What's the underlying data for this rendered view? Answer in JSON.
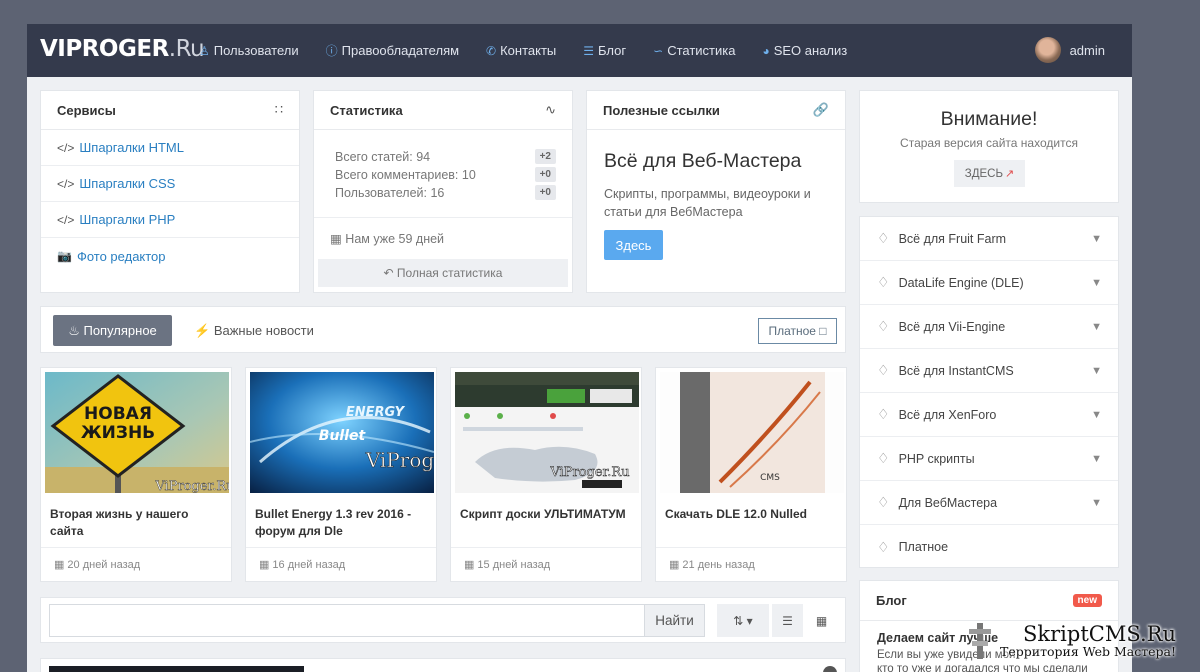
{
  "header": {
    "logo_main": "VIPROGER",
    "logo_suffix": ".Ru",
    "nav": [
      {
        "label": "Пользователи",
        "icon": "users-icon"
      },
      {
        "label": "Правообладателям",
        "icon": "info-icon"
      },
      {
        "label": "Контакты",
        "icon": "phone-icon"
      },
      {
        "label": "Блог",
        "icon": "stack-icon"
      },
      {
        "label": "Статистика",
        "icon": "chart-line-icon"
      },
      {
        "label": "SEO анализ",
        "icon": "pie-chart-icon"
      }
    ],
    "username": "admin"
  },
  "services": {
    "title": "Сервисы",
    "items": [
      {
        "label": "Шпаргалки HTML",
        "icon": "code-icon"
      },
      {
        "label": "Шпаргалки CSS",
        "icon": "code-icon"
      },
      {
        "label": "Шпаргалки PHP",
        "icon": "code-icon"
      },
      {
        "label": "Фото редактор",
        "icon": "camera-icon"
      }
    ]
  },
  "stats": {
    "title": "Статистика",
    "lines": [
      {
        "label": "Всего статей: 94",
        "badge": "+2"
      },
      {
        "label": "Всего комментариев: 10",
        "badge": "+0"
      },
      {
        "label": "Пользователей: 16",
        "badge": "+0"
      }
    ],
    "days": "Нам уже 59 дней",
    "full_link": "Полная статистика"
  },
  "links": {
    "title": "Полезные ссылки",
    "headline": "Всё для Веб-Мастера",
    "desc_line1": "Скрипты, программы, видеоуроки и",
    "desc_line2": "статьи для ВебМастера",
    "button": "Здесь"
  },
  "attention": {
    "title": "Внимание!",
    "subtitle": "Старая версия сайта находится",
    "button": "ЗДЕСЬ"
  },
  "categories": [
    {
      "label": "Всё для Fruit Farm",
      "expandable": true
    },
    {
      "label": "DataLife Engine (DLE)",
      "expandable": true
    },
    {
      "label": "Всё для Vii-Engine",
      "expandable": true
    },
    {
      "label": "Всё для InstantCMS",
      "expandable": true
    },
    {
      "label": "Всё для XenForo",
      "expandable": true
    },
    {
      "label": "PHP скрипты",
      "expandable": true
    },
    {
      "label": "Для ВебМастера",
      "expandable": true
    },
    {
      "label": "Платное",
      "expandable": false
    }
  ],
  "tabs": {
    "popular": "Популярное",
    "news": "Важные новости",
    "paid": "Платное"
  },
  "cards": [
    {
      "title": "Вторая жизнь у нашего сайта",
      "date": "20 дней назад",
      "thumb_text1": "НОВАЯ",
      "thumb_text2": "ЖИЗНЬ",
      "watermark": "ViProger.Ru"
    },
    {
      "title": "Bullet Energy 1.3 rev 2016 - форум для Dle",
      "date": "16 дней назад",
      "thumb_text1": "ENERGY",
      "thumb_text2": "Bullet",
      "watermark": "ViProg"
    },
    {
      "title": "Скрипт доски УЛЬТИМАТУМ",
      "date": "15 дней назад",
      "watermark": "ViProger.Ru"
    },
    {
      "title": "Скачать DLE 12.0 Nulled",
      "date": "21 день назад",
      "thumb_text1": "CMS"
    }
  ],
  "search": {
    "placeholder": "",
    "button": "Найти"
  },
  "blog": {
    "title": "Блог",
    "badge": "new",
    "post_title": "Делаем сайт лучше",
    "post_line1": "Если вы уже увидели мой",
    "post_line2": "кто то уже и догадался что мы сделали"
  },
  "watermark": {
    "line1": "SkriptCMS.Ru",
    "line2": "Территория Web Мастера!"
  },
  "colors": {
    "header_bg": "#343a4c",
    "link_blue": "#2a7fc1",
    "button_blue": "#5aa9ef",
    "tab_active": "#6b7382",
    "new_badge": "#f15a4b"
  }
}
